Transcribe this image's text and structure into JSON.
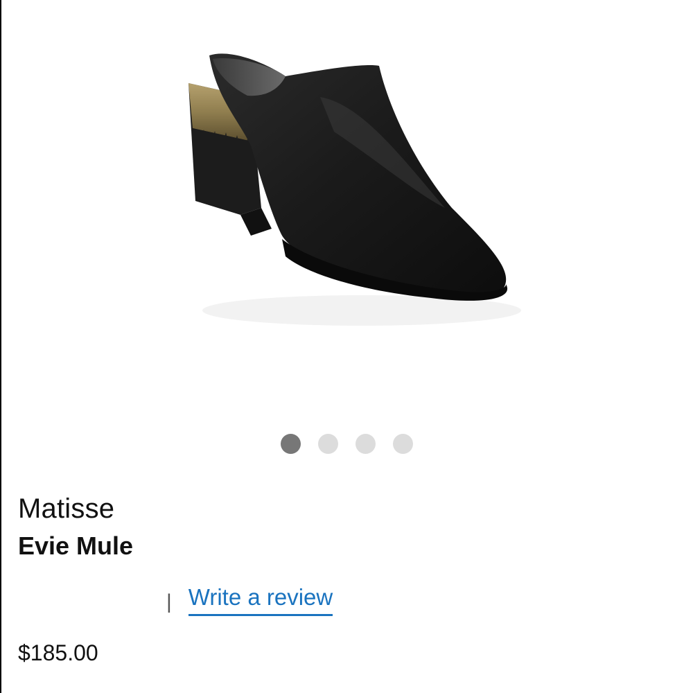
{
  "product": {
    "brand": "Matisse",
    "name": "Evie Mule",
    "price": "$185.00",
    "image_alt": "Evie Mule"
  },
  "carousel": {
    "active_index": 0,
    "dots": [
      "slide-1",
      "slide-2",
      "slide-3",
      "slide-4"
    ]
  },
  "review": {
    "divider": "|",
    "link_label": "Write a review"
  },
  "colors": {
    "link": "#1a73bf",
    "dot_active": "#777777",
    "dot_inactive": "#dcdcdc"
  }
}
